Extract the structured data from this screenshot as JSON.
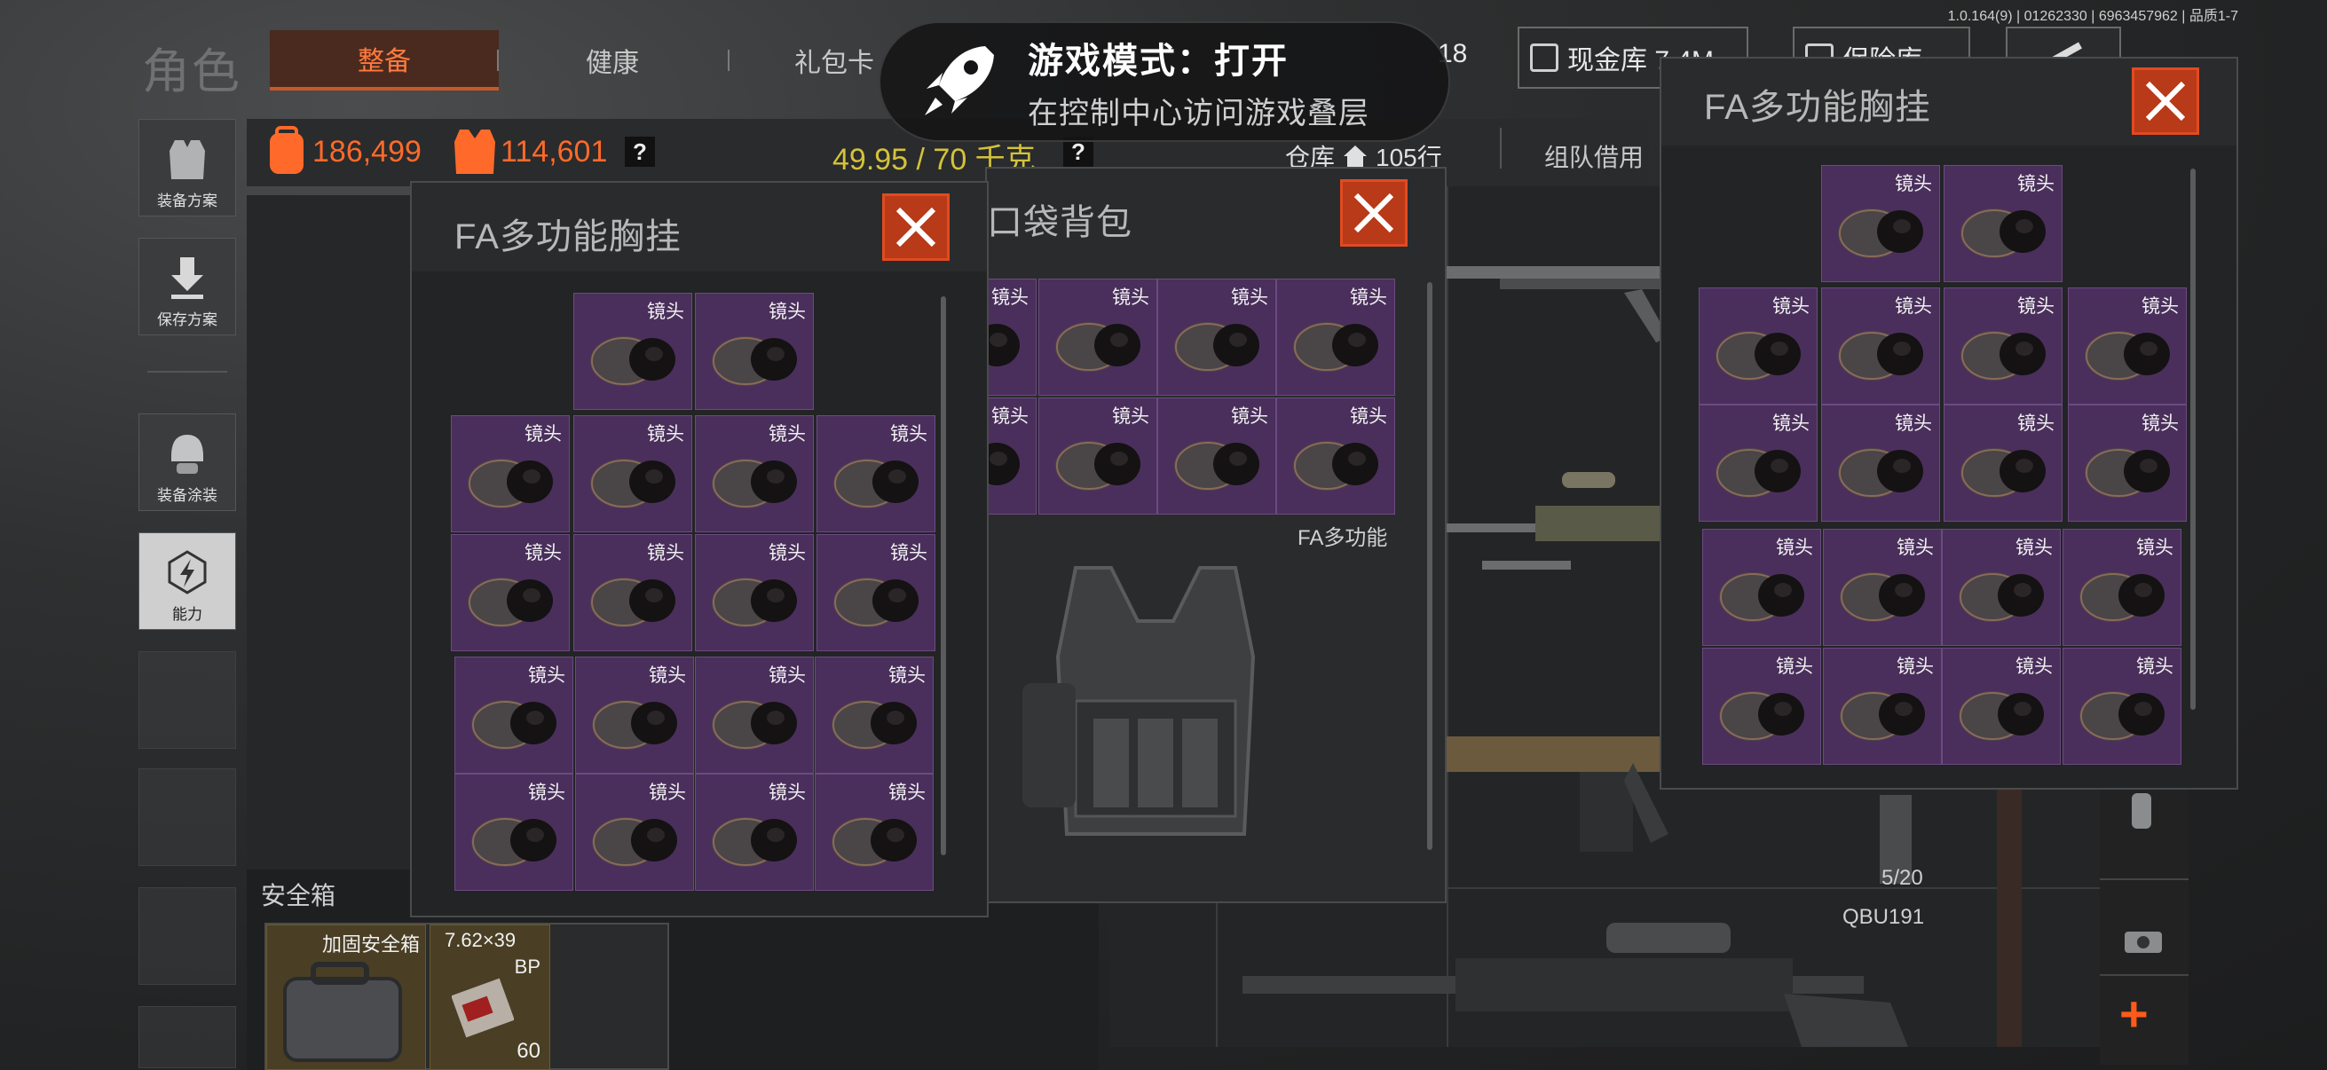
{
  "version": "1.0.164(9) | 01262330 | 6963457962 | 品质1-7",
  "header": {
    "title": "角色",
    "tabs": [
      {
        "label": "整备",
        "active": true
      },
      {
        "label": "健康"
      },
      {
        "label": "礼包卡"
      }
    ],
    "count_18": "18",
    "cash_label": "现金库 7.4M",
    "insurance_label": "保险库"
  },
  "notification": {
    "title": "游戏模式：打开",
    "subtitle": "在控制中心访问游戏叠层"
  },
  "sidebar": [
    {
      "label": "装备方案",
      "icon": "vest-icon"
    },
    {
      "label": "保存方案",
      "icon": "download-icon"
    },
    {
      "label": "装备涂装",
      "icon": "helmet-icon"
    },
    {
      "label": "能力",
      "icon": "lightning-icon"
    }
  ],
  "stats": {
    "value1": "186,499",
    "value2": "114,601",
    "weight": "49.95 / 70 千克",
    "help": "?"
  },
  "warehouse": {
    "label": "仓库",
    "rows": "105行",
    "team_borrow": "组队借用"
  },
  "panel_left": {
    "title": "FA多功能胸挂"
  },
  "panel_mid": {
    "title": "口袋背包",
    "vest_label": "FA多功能"
  },
  "panel_right": {
    "title": "FA多功能胸挂"
  },
  "item_label": "镜头",
  "safebox": {
    "title": "安全箱",
    "box_label": "加固安全箱",
    "ammo_caliber": "7.62×39",
    "ammo_type": "BP",
    "ammo_count": "60"
  },
  "weapon": {
    "ammo_status": "5/20",
    "name": "QBU191"
  },
  "colors": {
    "accent": "#ff6a2a",
    "item_purple": "#4a2f5c",
    "close_red": "#c43e1a",
    "weight_yellow": "#d4c23a"
  }
}
